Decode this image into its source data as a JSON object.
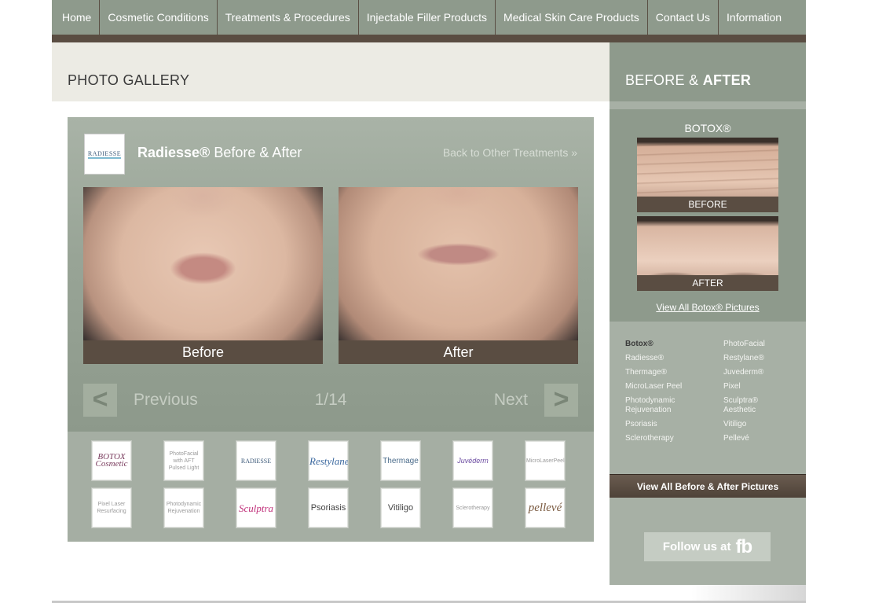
{
  "nav": {
    "items": [
      {
        "label": "Home"
      },
      {
        "label": "Cosmetic Conditions"
      },
      {
        "label": "Treatments & Procedures"
      },
      {
        "label": "Injectable Filler Products"
      },
      {
        "label": "Medical Skin Care Products"
      },
      {
        "label": "Contact Us"
      },
      {
        "label": "Information"
      }
    ]
  },
  "gallery": {
    "title": "PHOTO GALLERY",
    "logo_text": "RADIESSE",
    "treatment_name": "Radiesse®",
    "treatment_suffix": " Before & After",
    "back_link": "Back to Other Treatments »",
    "before_label": "Before",
    "after_label": "After",
    "prev_arrow": "<",
    "next_arrow": ">",
    "prev_label": "Previous",
    "next_label": "Next",
    "counter": "1/14"
  },
  "thumbs": [
    {
      "text": "BOTOX Cosmetic"
    },
    {
      "text": "PhotoFacial with AFT Pulsed Light"
    },
    {
      "text": "RADIESSE"
    },
    {
      "text": "Restylane"
    },
    {
      "text": "Thermage"
    },
    {
      "text": "Juvéderm"
    },
    {
      "text": "MicroLaserPeel"
    },
    {
      "text": "Pixel Laser Resurfacing"
    },
    {
      "text": "Photodynamic Rejuvenation"
    },
    {
      "text": "Sculptra"
    },
    {
      "text": "Psoriasis"
    },
    {
      "text": "Vitiligo"
    },
    {
      "text": "Sclerotherapy"
    },
    {
      "text": "pellevé"
    }
  ],
  "sidebar": {
    "title_plain": "BEFORE & ",
    "title_bold": "AFTER",
    "feature_title": "BOTOX®",
    "before_label": "BEFORE",
    "after_label": "AFTER",
    "view_all_link": "View All Botox® Pictures",
    "links": [
      {
        "label": "Botox®"
      },
      {
        "label": "PhotoFacial"
      },
      {
        "label": "Radiesse®"
      },
      {
        "label": "Restylane®"
      },
      {
        "label": "Thermage®"
      },
      {
        "label": "Juvederm®"
      },
      {
        "label": "MicroLaser Peel"
      },
      {
        "label": "Pixel"
      },
      {
        "label": "Photodynamic Rejuvenation"
      },
      {
        "label": "Sculptra® Aesthetic"
      },
      {
        "label": "Psoriasis"
      },
      {
        "label": "Vitiligo"
      },
      {
        "label": "Sclerotherapy"
      },
      {
        "label": "Pellevé"
      }
    ],
    "all_button": "View All Before & After Pictures",
    "fb_text": "Follow us at",
    "fb_logo": "fb"
  },
  "colors": {
    "nav_bg": "#8e9a8c",
    "brown_bar": "#5a4d42",
    "panel_bg": "#98a496",
    "sidebar_bg": "#a7b0a5"
  }
}
